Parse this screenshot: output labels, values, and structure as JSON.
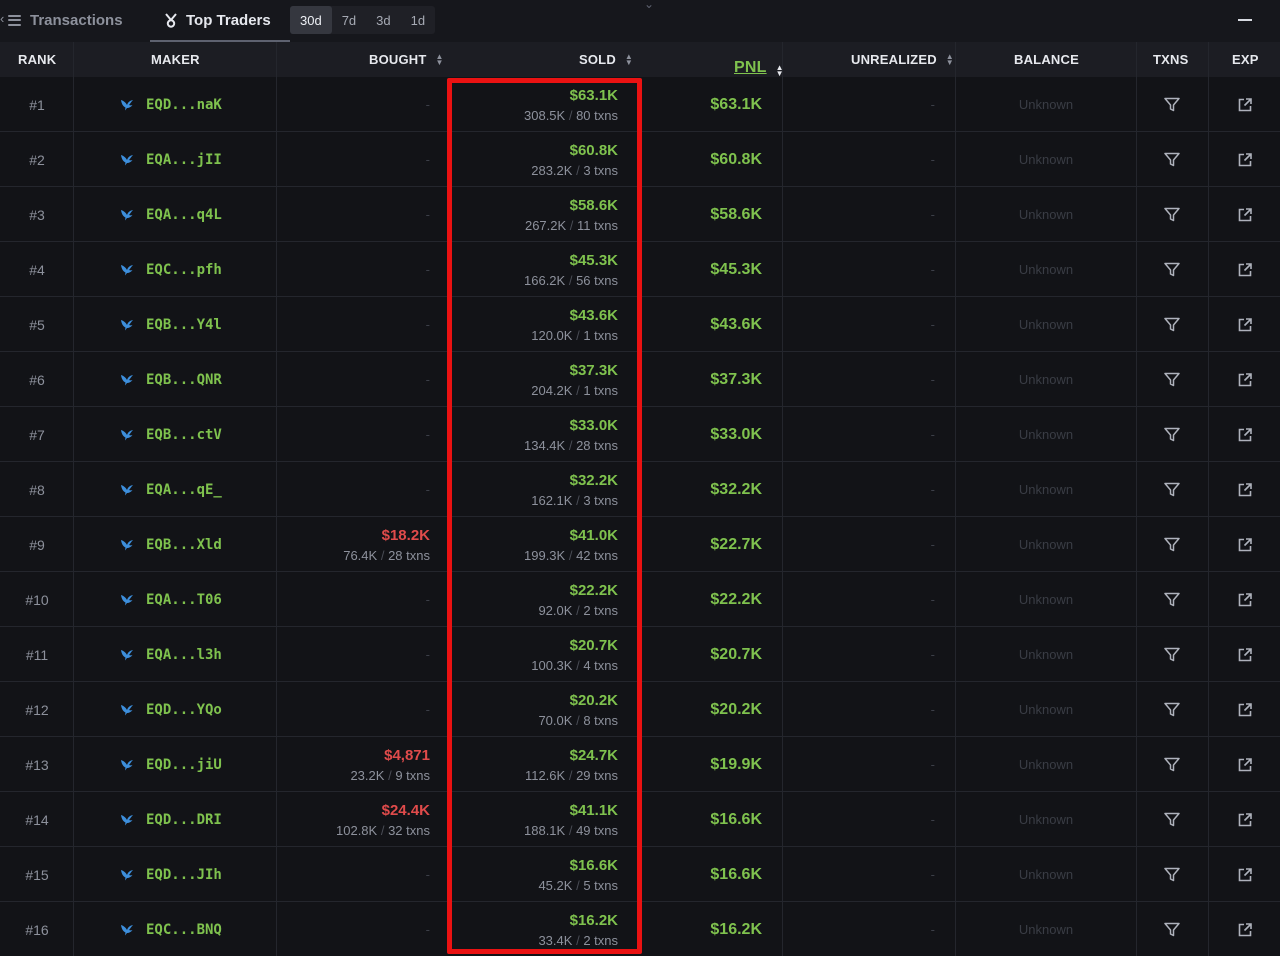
{
  "tabs": {
    "transactions": "Transactions",
    "top_traders": "Top Traders"
  },
  "periods": [
    "30d",
    "7d",
    "3d",
    "1d"
  ],
  "active_period": "30d",
  "columns": {
    "rank": "RANK",
    "maker": "MAKER",
    "bought": "BOUGHT",
    "sold": "SOLD",
    "pnl": "PNL",
    "unrealized": "UNREALIZED",
    "balance": "BALANCE",
    "txns": "TXNS",
    "exp": "EXP"
  },
  "colors": {
    "positive": "#7fc24e",
    "negative": "#e04b4b",
    "highlight": "#ea1212"
  },
  "rows": [
    {
      "rank": "#1",
      "maker": "EQD...naK",
      "bought": null,
      "sold": {
        "amount": "$63.1K",
        "tokens": "308.5K",
        "txns": "80 txns"
      },
      "pnl": "$63.1K",
      "unrealized": "-",
      "balance": "Unknown"
    },
    {
      "rank": "#2",
      "maker": "EQA...jII",
      "bought": null,
      "sold": {
        "amount": "$60.8K",
        "tokens": "283.2K",
        "txns": "3 txns"
      },
      "pnl": "$60.8K",
      "unrealized": "-",
      "balance": "Unknown"
    },
    {
      "rank": "#3",
      "maker": "EQA...q4L",
      "bought": null,
      "sold": {
        "amount": "$58.6K",
        "tokens": "267.2K",
        "txns": "11 txns"
      },
      "pnl": "$58.6K",
      "unrealized": "-",
      "balance": "Unknown"
    },
    {
      "rank": "#4",
      "maker": "EQC...pfh",
      "bought": null,
      "sold": {
        "amount": "$45.3K",
        "tokens": "166.2K",
        "txns": "56 txns"
      },
      "pnl": "$45.3K",
      "unrealized": "-",
      "balance": "Unknown"
    },
    {
      "rank": "#5",
      "maker": "EQB...Y4l",
      "bought": null,
      "sold": {
        "amount": "$43.6K",
        "tokens": "120.0K",
        "txns": "1 txns"
      },
      "pnl": "$43.6K",
      "unrealized": "-",
      "balance": "Unknown"
    },
    {
      "rank": "#6",
      "maker": "EQB...QNR",
      "bought": null,
      "sold": {
        "amount": "$37.3K",
        "tokens": "204.2K",
        "txns": "1 txns"
      },
      "pnl": "$37.3K",
      "unrealized": "-",
      "balance": "Unknown"
    },
    {
      "rank": "#7",
      "maker": "EQB...ctV",
      "bought": null,
      "sold": {
        "amount": "$33.0K",
        "tokens": "134.4K",
        "txns": "28 txns"
      },
      "pnl": "$33.0K",
      "unrealized": "-",
      "balance": "Unknown"
    },
    {
      "rank": "#8",
      "maker": "EQA...qE_",
      "bought": null,
      "sold": {
        "amount": "$32.2K",
        "tokens": "162.1K",
        "txns": "3 txns"
      },
      "pnl": "$32.2K",
      "unrealized": "-",
      "balance": "Unknown"
    },
    {
      "rank": "#9",
      "maker": "EQB...Xld",
      "bought": {
        "amount": "$18.2K",
        "tokens": "76.4K",
        "txns": "28 txns"
      },
      "sold": {
        "amount": "$41.0K",
        "tokens": "199.3K",
        "txns": "42 txns"
      },
      "pnl": "$22.7K",
      "unrealized": "-",
      "balance": "Unknown"
    },
    {
      "rank": "#10",
      "maker": "EQA...T06",
      "bought": null,
      "sold": {
        "amount": "$22.2K",
        "tokens": "92.0K",
        "txns": "2 txns"
      },
      "pnl": "$22.2K",
      "unrealized": "-",
      "balance": "Unknown"
    },
    {
      "rank": "#11",
      "maker": "EQA...l3h",
      "bought": null,
      "sold": {
        "amount": "$20.7K",
        "tokens": "100.3K",
        "txns": "4 txns"
      },
      "pnl": "$20.7K",
      "unrealized": "-",
      "balance": "Unknown"
    },
    {
      "rank": "#12",
      "maker": "EQD...YQo",
      "bought": null,
      "sold": {
        "amount": "$20.2K",
        "tokens": "70.0K",
        "txns": "8 txns"
      },
      "pnl": "$20.2K",
      "unrealized": "-",
      "balance": "Unknown"
    },
    {
      "rank": "#13",
      "maker": "EQD...jiU",
      "bought": {
        "amount": "$4,871",
        "tokens": "23.2K",
        "txns": "9 txns"
      },
      "sold": {
        "amount": "$24.7K",
        "tokens": "112.6K",
        "txns": "29 txns"
      },
      "pnl": "$19.9K",
      "unrealized": "-",
      "balance": "Unknown"
    },
    {
      "rank": "#14",
      "maker": "EQD...DRI",
      "bought": {
        "amount": "$24.4K",
        "tokens": "102.8K",
        "txns": "32 txns"
      },
      "sold": {
        "amount": "$41.1K",
        "tokens": "188.1K",
        "txns": "49 txns"
      },
      "pnl": "$16.6K",
      "unrealized": "-",
      "balance": "Unknown"
    },
    {
      "rank": "#15",
      "maker": "EQD...JIh",
      "bought": null,
      "sold": {
        "amount": "$16.6K",
        "tokens": "45.2K",
        "txns": "5 txns"
      },
      "pnl": "$16.6K",
      "unrealized": "-",
      "balance": "Unknown"
    },
    {
      "rank": "#16",
      "maker": "EQC...BNQ",
      "bought": null,
      "sold": {
        "amount": "$16.2K",
        "tokens": "33.4K",
        "txns": "2 txns"
      },
      "pnl": "$16.2K",
      "unrealized": "-",
      "balance": "Unknown"
    }
  ]
}
